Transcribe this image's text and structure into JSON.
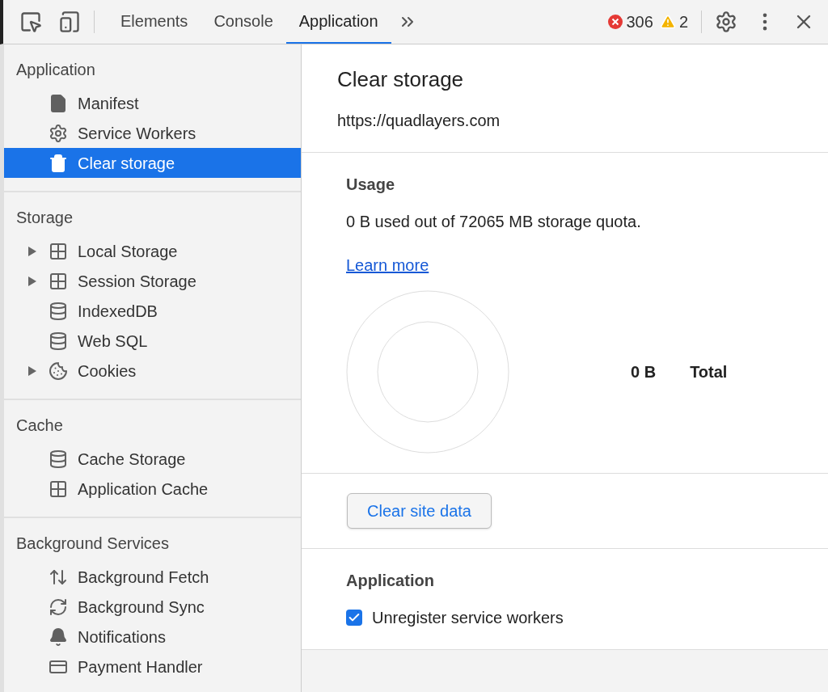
{
  "toolbar": {
    "tabs": [
      {
        "label": "Elements",
        "selected": false
      },
      {
        "label": "Console",
        "selected": false
      },
      {
        "label": "Application",
        "selected": true
      }
    ],
    "errors": "306",
    "warnings": "2"
  },
  "sidebar": {
    "sections": [
      {
        "title": "Application",
        "items": [
          {
            "label": "Manifest",
            "kind": "file",
            "selected": false
          },
          {
            "label": "Service Workers",
            "kind": "gear",
            "selected": false
          },
          {
            "label": "Clear storage",
            "kind": "trash",
            "selected": true
          }
        ]
      },
      {
        "title": "Storage",
        "items": [
          {
            "label": "Local Storage",
            "kind": "table",
            "expanded": false,
            "selected": false
          },
          {
            "label": "Session Storage",
            "kind": "table",
            "expanded": false,
            "selected": false
          },
          {
            "label": "IndexedDB",
            "kind": "database",
            "selected": false
          },
          {
            "label": "Web SQL",
            "kind": "database",
            "selected": false
          },
          {
            "label": "Cookies",
            "kind": "cookie",
            "expanded": false,
            "selected": false
          }
        ]
      },
      {
        "title": "Cache",
        "items": [
          {
            "label": "Cache Storage",
            "kind": "database",
            "selected": false
          },
          {
            "label": "Application Cache",
            "kind": "table",
            "selected": false
          }
        ]
      },
      {
        "title": "Background Services",
        "items": [
          {
            "label": "Background Fetch",
            "kind": "updown",
            "selected": false
          },
          {
            "label": "Background Sync",
            "kind": "sync",
            "selected": false
          },
          {
            "label": "Notifications",
            "kind": "bell",
            "selected": false
          },
          {
            "label": "Payment Handler",
            "kind": "card",
            "selected": false
          }
        ]
      }
    ]
  },
  "main": {
    "title": "Clear storage",
    "origin": "https://quadlayers.com",
    "usage": {
      "heading": "Usage",
      "text": "0 B used out of 72065 MB storage quota.",
      "link": "Learn more",
      "total_value": "0 B",
      "total_label": "Total"
    },
    "clear_button": "Clear site data",
    "application": {
      "heading": "Application",
      "options": [
        {
          "label": "Unregister service workers",
          "checked": true
        }
      ]
    }
  }
}
